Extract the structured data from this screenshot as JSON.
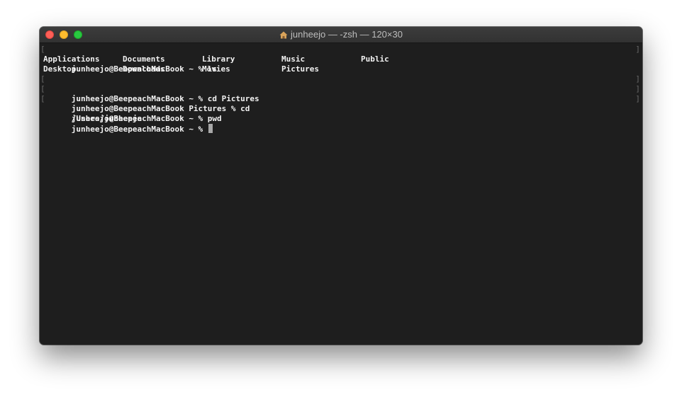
{
  "window": {
    "title": "junheejo — -zsh — 120×30",
    "icons": {
      "title": "home-icon",
      "close": "close-button",
      "minimize": "minimize-button",
      "zoom": "zoom-button"
    },
    "colors": {
      "background": "#1e1e1e",
      "text": "#f2f2f2",
      "close": "#fe5f57",
      "minimize": "#febc2e",
      "zoom": "#28c840"
    }
  },
  "terminal": {
    "bracket_left": "[",
    "bracket_right": "]",
    "lines": [
      {
        "text": "junheejo@BeepeachMacBook ~ % ls"
      },
      {
        "text": "junheejo@BeepeachMacBook ~ % cd Pictures"
      },
      {
        "text": "junheejo@BeepeachMacBook Pictures % cd"
      },
      {
        "text": "junheejo@BeepeachMacBook ~ % pwd"
      },
      {
        "text": "/Users/junheejo"
      },
      {
        "text": "junheejo@BeepeachMacBook ~ % "
      }
    ],
    "ls_output": [
      [
        "Applications",
        "Documents",
        "Library",
        "Music",
        "Public"
      ],
      [
        "Desktop",
        "Downloads",
        "Movies",
        "Pictures",
        ""
      ]
    ]
  }
}
